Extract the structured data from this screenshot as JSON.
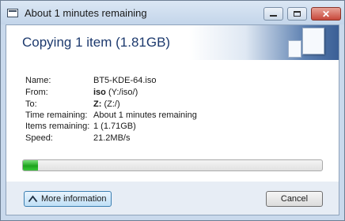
{
  "window": {
    "title": "About 1 minutes remaining"
  },
  "header": {
    "title": "Copying 1 item (1.81GB)"
  },
  "details": {
    "name_label": "Name:",
    "name_value": "BT5-KDE-64.iso",
    "from_label": "From:",
    "from_bold": "iso",
    "from_rest": " (Y:/iso/)",
    "to_label": "To:",
    "to_bold": "Z:",
    "to_rest": " (Z:/)",
    "time_label": "Time remaining:",
    "time_value": "About 1 minutes remaining",
    "items_label": "Items remaining:",
    "items_value": "1 (1.71GB)",
    "speed_label": "Speed:",
    "speed_value": "21.2MB/s"
  },
  "progress": {
    "fraction": 0.05,
    "color": "#1ea31e"
  },
  "buttons": {
    "more_info": "More information",
    "cancel": "Cancel"
  },
  "icons": {
    "more_info": "chevron-up-icon",
    "window": "window-icon"
  }
}
